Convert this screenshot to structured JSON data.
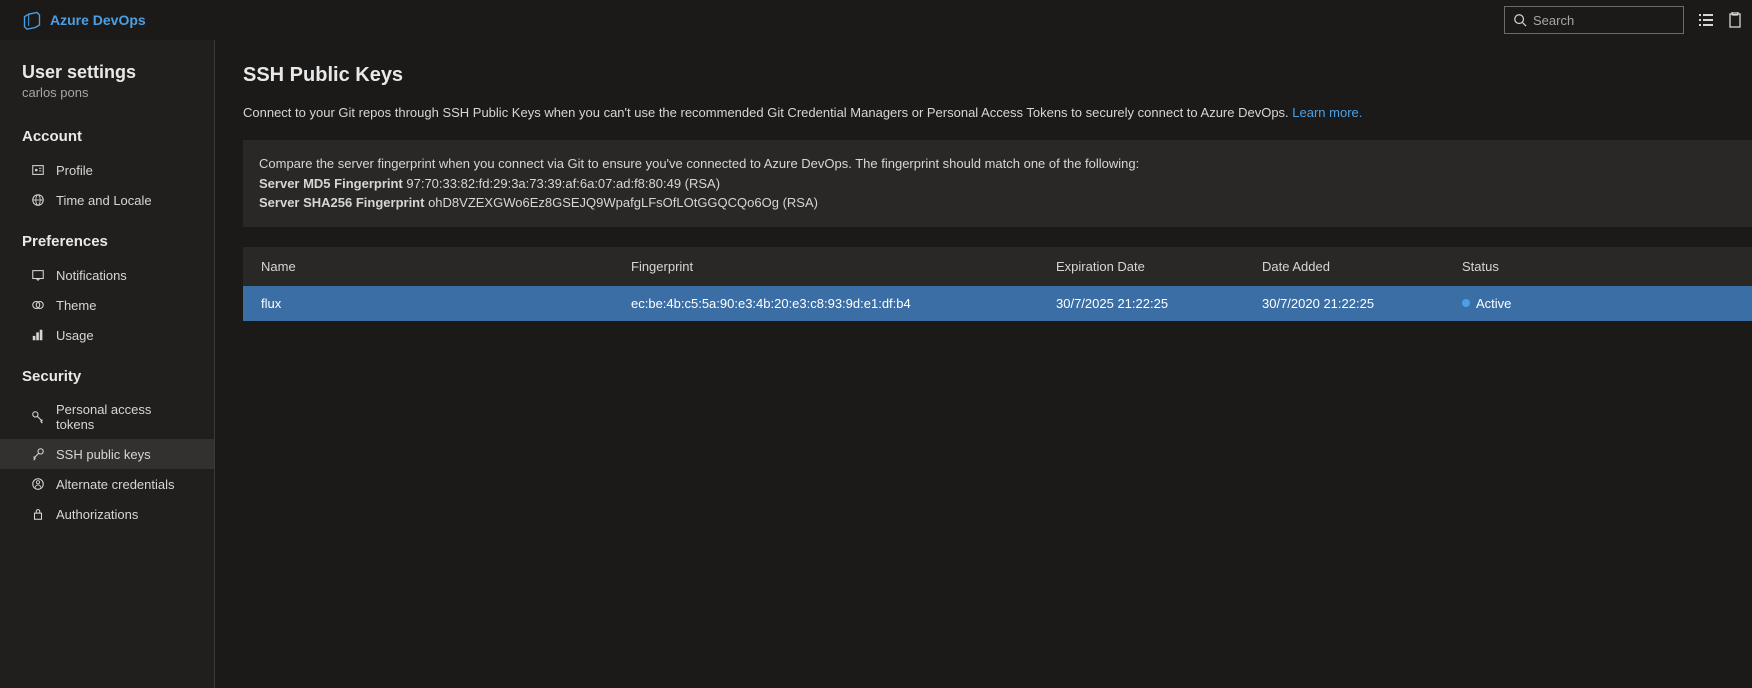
{
  "header": {
    "brand": "Azure DevOps",
    "search_placeholder": "Search"
  },
  "sidebar": {
    "title": "User settings",
    "username": "carlos pons",
    "sections": {
      "account": {
        "label": "Account",
        "items": [
          {
            "label": "Profile"
          },
          {
            "label": "Time and Locale"
          }
        ]
      },
      "preferences": {
        "label": "Preferences",
        "items": [
          {
            "label": "Notifications"
          },
          {
            "label": "Theme"
          },
          {
            "label": "Usage"
          }
        ]
      },
      "security": {
        "label": "Security",
        "items": [
          {
            "label": "Personal access tokens"
          },
          {
            "label": "SSH public keys"
          },
          {
            "label": "Alternate credentials"
          },
          {
            "label": "Authorizations"
          }
        ]
      }
    }
  },
  "content": {
    "title": "SSH Public Keys",
    "description_text": "Connect to your Git repos through SSH Public Keys when you can't use the recommended Git Credential Managers or Personal Access Tokens to securely connect to Azure DevOps. ",
    "learn_more": "Learn more.",
    "fingerprint_intro": "Compare the server fingerprint when you connect via Git to ensure you've connected to Azure DevOps. The fingerprint should match one of the following:",
    "md5_label": "Server MD5 Fingerprint",
    "md5_value": " 97:70:33:82:fd:29:3a:73:39:af:6a:07:ad:f8:80:49 (RSA)",
    "sha256_label": "Server SHA256 Fingerprint",
    "sha256_value": " ohD8VZEXGWo6Ez8GSEJQ9WpafgLFsOfLOtGGQCQo6Og (RSA)",
    "table": {
      "headers": {
        "name": "Name",
        "fingerprint": "Fingerprint",
        "expiration": "Expiration Date",
        "added": "Date Added",
        "status": "Status"
      },
      "rows": [
        {
          "name": "flux",
          "fingerprint": "ec:be:4b:c5:5a:90:e3:4b:20:e3:c8:93:9d:e1:df:b4",
          "expiration": "30/7/2025 21:22:25",
          "added": "30/7/2020 21:22:25",
          "status": "Active"
        }
      ]
    }
  }
}
